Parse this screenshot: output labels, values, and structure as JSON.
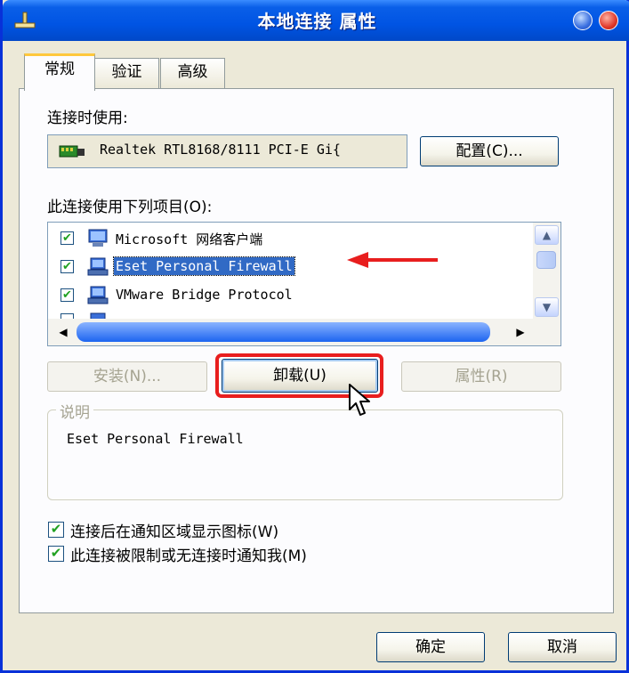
{
  "window": {
    "title": "本地连接 属性"
  },
  "tabs": [
    {
      "label": "常规",
      "active": true
    },
    {
      "label": "验证",
      "active": false
    },
    {
      "label": "高级",
      "active": false
    }
  ],
  "connect_using": {
    "label": "连接时使用:",
    "adapter": "Realtek RTL8168/8111 PCI-E Gi{",
    "configure_button": "配置(C)..."
  },
  "items_section": {
    "label": "此连接使用下列项目(O):",
    "items": [
      {
        "label": "Microsoft 网络客户端",
        "checked": true,
        "selected": false,
        "icon": "network-client-icon"
      },
      {
        "label": "Eset Personal Firewall",
        "checked": true,
        "selected": true,
        "icon": "network-service-icon"
      },
      {
        "label": "VMware Bridge Protocol",
        "checked": true,
        "selected": false,
        "icon": "network-protocol-icon"
      }
    ]
  },
  "buttons": {
    "install": "安装(N)...",
    "uninstall": "卸载(U)",
    "properties": "属性(R)"
  },
  "description": {
    "title": "说明",
    "text": "Eset Personal Firewall"
  },
  "options": [
    {
      "label": "连接后在通知区域显示图标(W)",
      "checked": true
    },
    {
      "label": "此连接被限制或无连接时通知我(M)",
      "checked": true
    }
  ],
  "footer": {
    "ok": "确定",
    "cancel": "取消"
  },
  "colors": {
    "titlebar": "#0054E3",
    "selection": "#316AC5",
    "annotation": "#E81E1E"
  }
}
